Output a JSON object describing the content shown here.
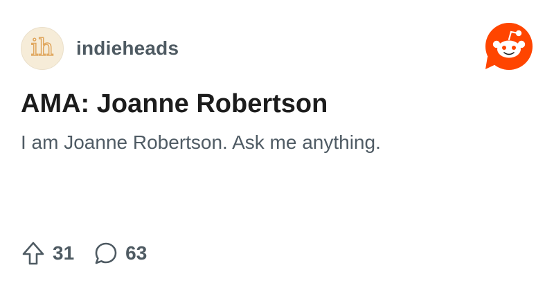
{
  "post": {
    "subreddit": {
      "name": "indieheads",
      "avatar_text": "ih",
      "avatar_icon": "subreddit-avatar-icon"
    },
    "brand_icon": "reddit-logo-icon",
    "title": "AMA: Joanne Robertson",
    "body": "I am Joanne Robertson. Ask me anything.",
    "stats": {
      "upvotes": "31",
      "upvote_icon": "upvote-arrow-icon",
      "comments": "63",
      "comment_icon": "comment-bubble-icon"
    }
  },
  "colors": {
    "brand": "#ff4500",
    "text_primary": "#1c1c1c",
    "text_secondary": "#4e5a62",
    "avatar_bg": "#f6ecd8",
    "avatar_accent": "#e0a75e"
  }
}
